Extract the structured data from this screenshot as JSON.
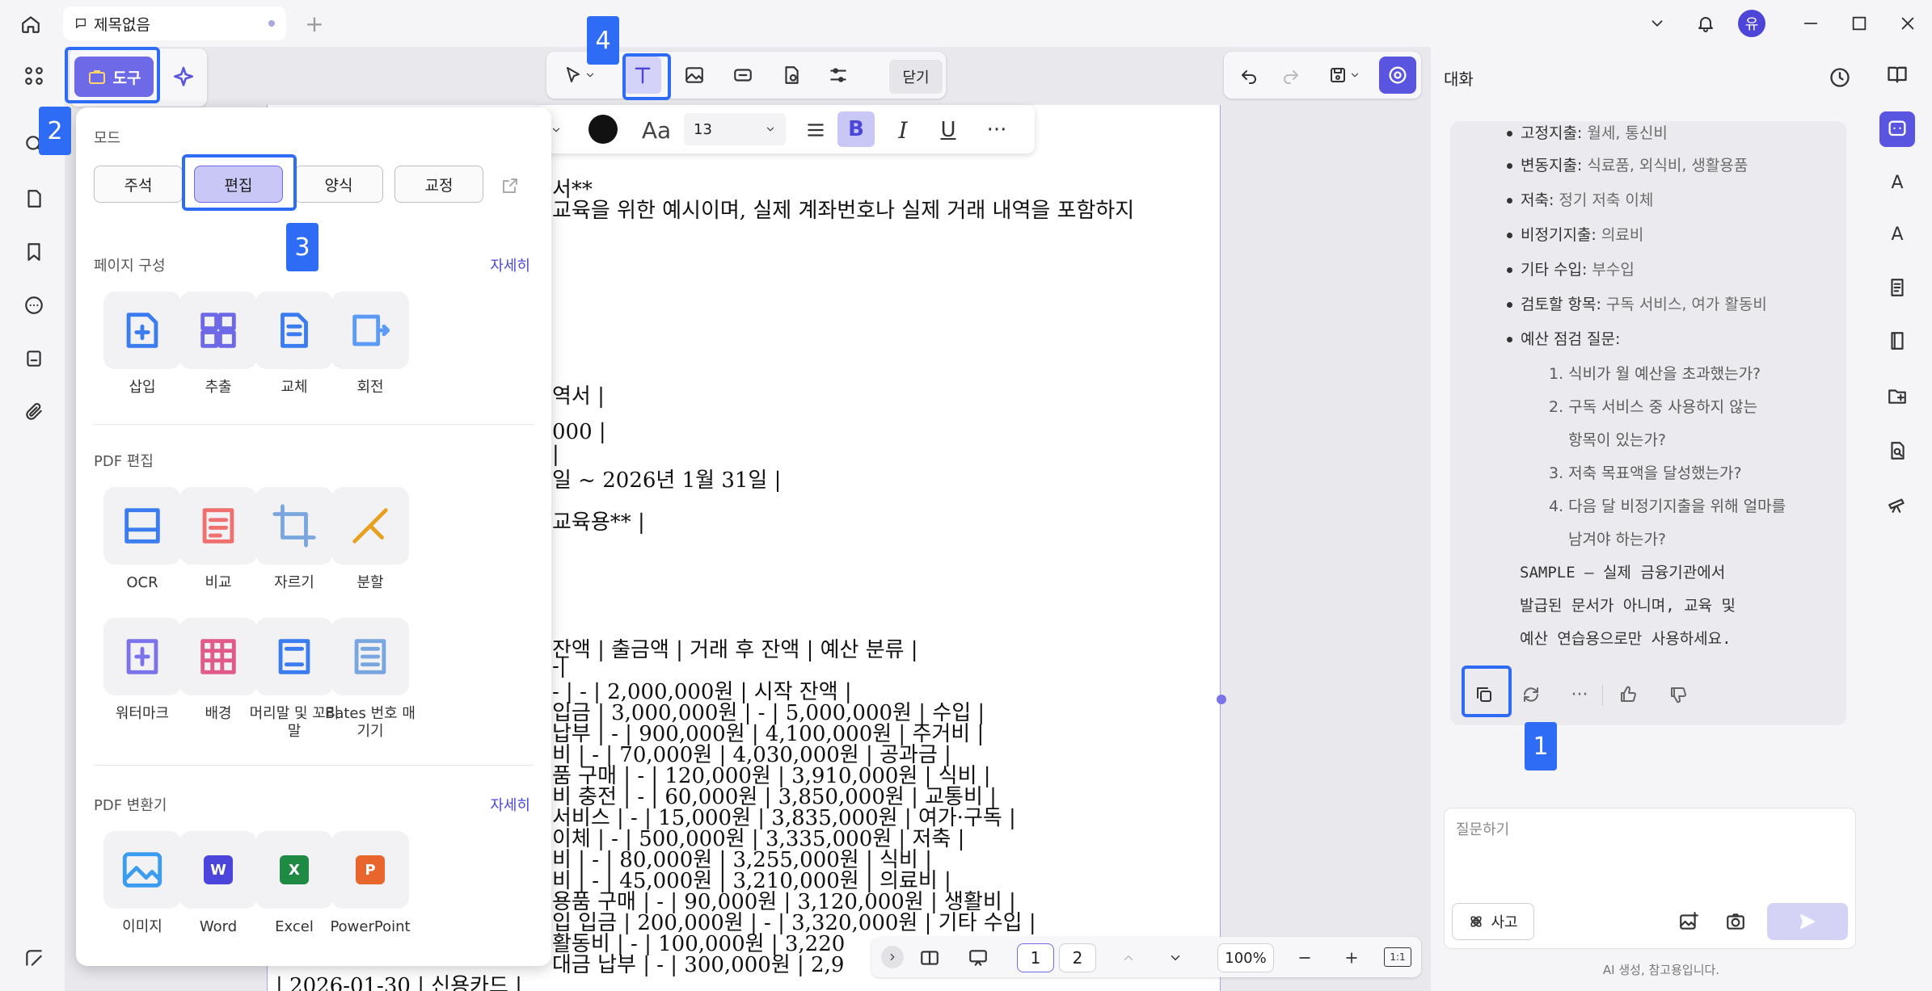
{
  "titlebar": {
    "tab_title": "제목없음",
    "avatar_initial": "유"
  },
  "toolbar": {
    "tool_label": "도구",
    "close_label": "닫기",
    "font_size": "13"
  },
  "panel": {
    "mode_title": "모드",
    "modes": [
      "주석",
      "편집",
      "양식",
      "교정"
    ],
    "page_section": {
      "title": "페이지 구성",
      "more": "자세히",
      "items": [
        "삽입",
        "추출",
        "교체",
        "회전"
      ]
    },
    "edit_section": {
      "title": "PDF 편집",
      "items": [
        "OCR",
        "비교",
        "자르기",
        "분할",
        "워터마크",
        "배경",
        "머리말 및 꼬리말",
        "Bates 번호 매기기"
      ]
    },
    "convert_section": {
      "title": "PDF 변환기",
      "more": "자세히",
      "items": [
        "이미지",
        "Word",
        "Excel",
        "PowerPoint"
      ]
    }
  },
  "document": {
    "lines": [
      "서**",
      "교육을 위한 예시이며, 실제 계좌번호나 실제 거래 내역을 포함하지",
      "역서 |",
      "000 |",
      "|",
      "일 ~ 2026년 1월 31일 |",
      "교육용** |",
      "잔액 | 출금액 | 거래 후 잔액 | 예산 분류 |",
      "-|",
      "- | - | 2,000,000원 | 시작 잔액 |",
      "입금 | 3,000,000원 | - | 5,000,000원 | 수입 |",
      "납부 | - | 900,000원 | 4,100,000원 | 주거비 |",
      "비 | - | 70,000원 | 4,030,000원 | 공과금 |",
      "품 구매 | - | 120,000원 | 3,910,000원 | 식비 |",
      "비 충전 | - | 60,000원 | 3,850,000원 | 교통비 |",
      "서비스 | - | 15,000원 | 3,835,000원 | 여가·구독 |",
      "이체 | - | 500,000원 | 3,335,000원 | 저축 |",
      "비 | - | 80,000원 | 3,255,000원 | 식비 |",
      "비 | - | 45,000원 | 3,210,000원 | 의료비 |",
      "용품 구매 | - | 90,000원 | 3,120,000원 | 생활비 |",
      "입 입금 | 200,000원 | - | 3,320,000원 | 기타 수입 |",
      "활동비 | - | 100,000원 | 3,220",
      "대금 납부 | - | 300,000원 | 2,9",
      "| 2026-01-30 | 신용카드 |"
    ]
  },
  "pager": {
    "page1": "1",
    "page2": "2",
    "zoom": "100%"
  },
  "chat": {
    "title": "대화",
    "bullets": [
      {
        "k": "고정지출:",
        "v": "월세, 통신비"
      },
      {
        "k": "변동지출:",
        "v": "식료품, 외식비, 생활용품"
      },
      {
        "k": "저축:",
        "v": "정기 저축 이체"
      },
      {
        "k": "비정기지출:",
        "v": "의료비"
      },
      {
        "k": "기타 수입:",
        "v": "부수입"
      },
      {
        "k": "검토할 항목:",
        "v": "구독 서비스, 여가 활동비"
      },
      {
        "k": "예산 점검 질문:",
        "v": ""
      }
    ],
    "questions": [
      "1. 식비가 월 예산을 초과했는가?",
      "2. 구독 서비스 중 사용하지 않는",
      "항목이 있는가?",
      "3. 저축 목표액을 달성했는가?",
      "4. 다음 달 비정기지출을 위해 얼마를",
      "남겨야 하는가?"
    ],
    "sample": [
      "SAMPLE — 실제 금융기관에서",
      "발급된 문서가 아니며, 교육 및",
      "예산 연습용으로만 사용하세요."
    ],
    "input_placeholder": "질문하기",
    "think_label": "사고",
    "disclaimer": "AI 생성, 참고용입니다."
  },
  "callouts": [
    "1",
    "2",
    "3",
    "4"
  ],
  "colors": {
    "accent": "#6e69e6",
    "callout": "#2f6cf6"
  }
}
